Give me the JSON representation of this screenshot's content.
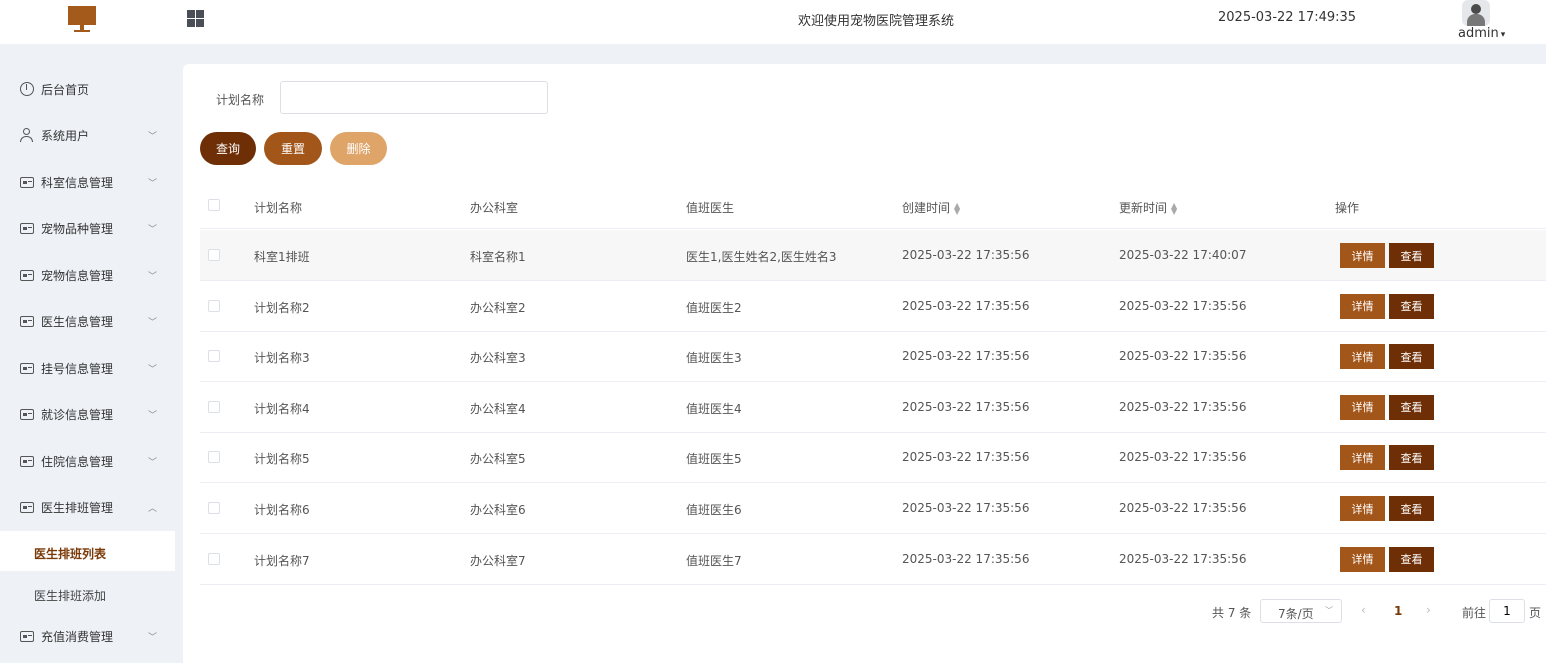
{
  "header": {
    "welcome": "欢迎使用宠物医院管理系统",
    "datetime": "2025-03-22 17:49:35",
    "user": "admin",
    "brand_color": "#a35a1a"
  },
  "sidebar": {
    "items": [
      {
        "label": "后台首页",
        "icon": "clock-icon"
      },
      {
        "label": "系统用户",
        "icon": "user-icon"
      },
      {
        "label": "科室信息管理",
        "icon": "card-icon"
      },
      {
        "label": "宠物品种管理",
        "icon": "card-icon"
      },
      {
        "label": "宠物信息管理",
        "icon": "card-icon"
      },
      {
        "label": "医生信息管理",
        "icon": "card-icon"
      },
      {
        "label": "挂号信息管理",
        "icon": "card-icon"
      },
      {
        "label": "就诊信息管理",
        "icon": "card-icon"
      },
      {
        "label": "住院信息管理",
        "icon": "card-icon"
      },
      {
        "label": "医生排班管理",
        "icon": "card-icon",
        "expanded": true
      },
      {
        "label": "充值消费管理",
        "icon": "card-icon"
      }
    ],
    "submenu": [
      {
        "label": "医生排班列表",
        "active": true
      },
      {
        "label": "医生排班添加",
        "active": false
      }
    ]
  },
  "search": {
    "label": "计划名称",
    "value": "",
    "placeholder": ""
  },
  "buttons": {
    "query": "查询",
    "reset": "重置",
    "delete": "删除"
  },
  "table": {
    "columns": [
      "计划名称",
      "办公科室",
      "值班医生",
      "创建时间",
      "更新时间",
      "操作"
    ],
    "action_detail": "详情",
    "action_view": "查看",
    "rows": [
      [
        "科室1排班",
        "科室名称1",
        "医生1,医生姓名2,医生姓名3",
        "2025-03-22 17:35:56",
        "2025-03-22 17:40:07"
      ],
      [
        "计划名称2",
        "办公科室2",
        "值班医生2",
        "2025-03-22 17:35:56",
        "2025-03-22 17:35:56"
      ],
      [
        "计划名称3",
        "办公科室3",
        "值班医生3",
        "2025-03-22 17:35:56",
        "2025-03-22 17:35:56"
      ],
      [
        "计划名称4",
        "办公科室4",
        "值班医生4",
        "2025-03-22 17:35:56",
        "2025-03-22 17:35:56"
      ],
      [
        "计划名称5",
        "办公科室5",
        "值班医生5",
        "2025-03-22 17:35:56",
        "2025-03-22 17:35:56"
      ],
      [
        "计划名称6",
        "办公科室6",
        "值班医生6",
        "2025-03-22 17:35:56",
        "2025-03-22 17:35:56"
      ],
      [
        "计划名称7",
        "办公科室7",
        "值班医生7",
        "2025-03-22 17:35:56",
        "2025-03-22 17:35:56"
      ]
    ]
  },
  "pagination": {
    "total": "共 7 条",
    "page_size": "7条/页",
    "current_page": "1",
    "goto_label": "前往",
    "goto_value": "1",
    "page_suffix": "页"
  }
}
